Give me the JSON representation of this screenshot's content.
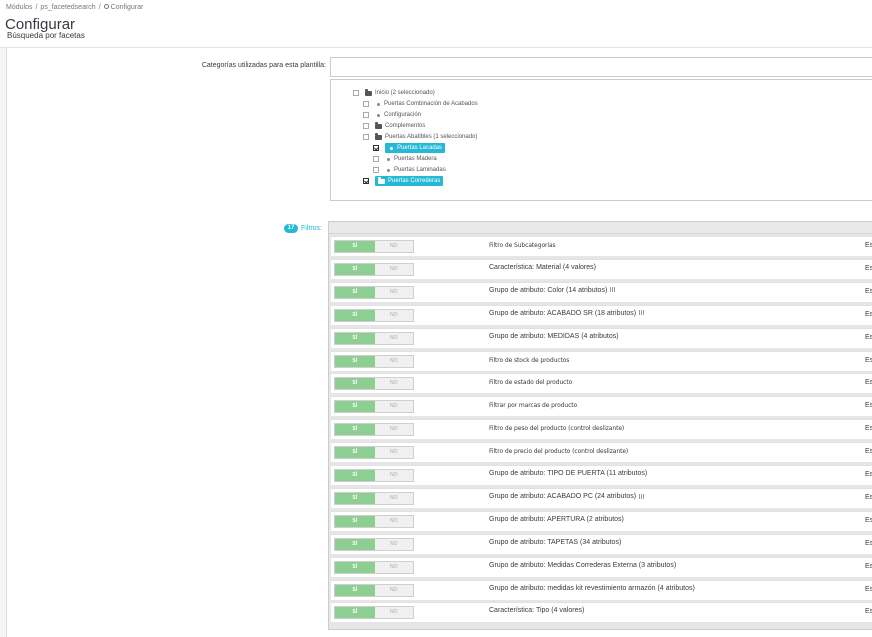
{
  "breadcrumb": {
    "items": [
      "Módulos",
      "ps_facetedsearch",
      "Configurar"
    ]
  },
  "header": {
    "title": "Configurar",
    "subtitle": "Búsqueda por facetas"
  },
  "categories": {
    "label": "Categorías utilizadas para esta plantilla:",
    "tree": [
      {
        "label": "Inicio (2 seleccionado)",
        "level": 0,
        "icon": "folder-open-icon",
        "checked": false,
        "highlighted": false
      },
      {
        "label": "Puertas Combinación de Acabados",
        "level": 1,
        "icon": "dot-icon",
        "checked": false,
        "highlighted": false
      },
      {
        "label": "Configuración",
        "level": 1,
        "icon": "dot-icon",
        "checked": false,
        "highlighted": false
      },
      {
        "label": "Complementos",
        "level": 1,
        "icon": "folder-icon",
        "checked": false,
        "highlighted": false
      },
      {
        "label": "Puertas Abatibles (1 seleccionado)",
        "level": 1,
        "icon": "folder-open-icon",
        "checked": false,
        "highlighted": false
      },
      {
        "label": "Puertas Lacadas",
        "level": 2,
        "icon": "dot-icon",
        "checked": true,
        "highlighted": true
      },
      {
        "label": "Puertas Madera",
        "level": 2,
        "icon": "dot-icon",
        "checked": false,
        "highlighted": false
      },
      {
        "label": "Puertas Laminadas",
        "level": 2,
        "icon": "dot-icon",
        "checked": false,
        "highlighted": false
      },
      {
        "label": "Puertas Correderas",
        "level": 1,
        "icon": "folder-icon",
        "checked": true,
        "highlighted": true
      }
    ]
  },
  "filters": {
    "count": "17",
    "label": "Filtros:",
    "yes_label": "SÍ",
    "no_label": "NO",
    "trailing_text": "Est",
    "rows": [
      {
        "name": "Filtro de Subcategorías",
        "condensed": true,
        "has_icon": false
      },
      {
        "name": "Característica: Material (4 valores)",
        "condensed": false,
        "has_icon": false
      },
      {
        "name": "Grupo de atributo: Color (14 atributos)",
        "condensed": false,
        "has_icon": true
      },
      {
        "name": "Grupo de atributo: ACABADO SR (18 atributos)",
        "condensed": false,
        "has_icon": true
      },
      {
        "name": "Grupo de atributo: MEDIDAS (4 atributos)",
        "condensed": false,
        "has_icon": false
      },
      {
        "name": "Filtro de stock de productos",
        "condensed": true,
        "has_icon": false
      },
      {
        "name": "Filtro de estado del producto",
        "condensed": true,
        "has_icon": false
      },
      {
        "name": "Filtrar por marcas de producto",
        "condensed": true,
        "has_icon": false
      },
      {
        "name": "Filtro de peso del producto (control deslizante)",
        "condensed": true,
        "has_icon": false
      },
      {
        "name": "Filtro de precio del producto (control deslizante)",
        "condensed": true,
        "has_icon": false
      },
      {
        "name": "Grupo de atributo: TIPO DE PUERTA (11 atributos)",
        "condensed": false,
        "has_icon": false
      },
      {
        "name": "Grupo de atributo: ACABADO PC (24 atributos)",
        "condensed": false,
        "has_icon": true
      },
      {
        "name": "Grupo de atributo: APERTURA (2 atributos)",
        "condensed": false,
        "has_icon": false
      },
      {
        "name": "Grupo de atributo: TAPETAS (34 atributos)",
        "condensed": false,
        "has_icon": false
      },
      {
        "name": "Grupo de atributo: Medidas Correderas Externa (3 atributos)",
        "condensed": false,
        "has_icon": false
      },
      {
        "name": "Grupo de atributo: medidas kit revestimiento armazón (4 atributos)",
        "condensed": false,
        "has_icon": false
      },
      {
        "name": "Característica: Tipo (4 valores)",
        "condensed": false,
        "has_icon": false
      }
    ]
  }
}
